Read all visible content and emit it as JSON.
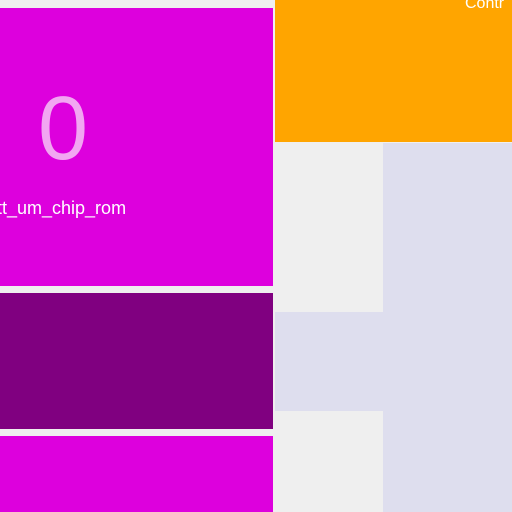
{
  "tiles": [
    {
      "name": "tt_um_chip_rom",
      "count": "0",
      "color": "#dd00dd"
    },
    {
      "name": "",
      "color": "#800080"
    },
    {
      "name": "",
      "color": "#dd00dd"
    }
  ],
  "orange_tile": {
    "label": "Contr",
    "color": "#ffa500"
  },
  "colors": {
    "background": "#efefef",
    "lavender": "#dedeee"
  }
}
